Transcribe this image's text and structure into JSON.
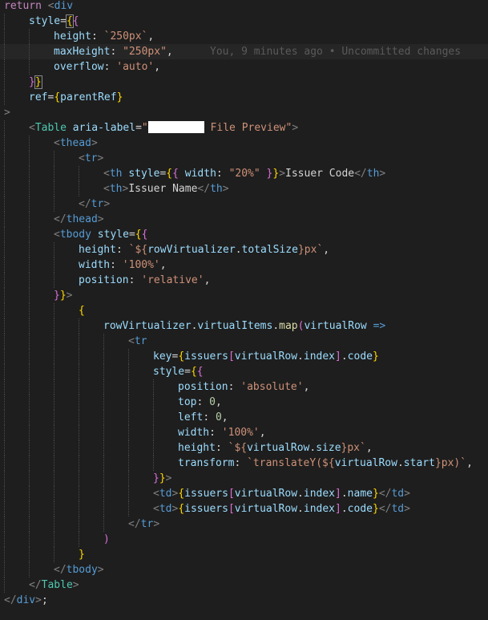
{
  "editor": {
    "blame": "You, 9 minutes ago • Uncommitted changes",
    "lines": [
      {
        "i": 0,
        "t": [
          [
            "kw",
            "return"
          ],
          [
            "txt",
            " "
          ],
          [
            "punc",
            "<"
          ],
          [
            "tag",
            "div"
          ]
        ]
      },
      {
        "i": 1,
        "t": [
          [
            "attr",
            "style"
          ],
          [
            "txt",
            "="
          ],
          [
            "br1",
            "{"
          ],
          [
            "br2",
            "{"
          ]
        ]
      },
      {
        "i": 2,
        "t": [
          [
            "attr",
            "height"
          ],
          [
            "txt",
            ": "
          ],
          [
            "str",
            "`250px`"
          ],
          [
            "txt",
            ","
          ]
        ]
      },
      {
        "i": 2,
        "t": [
          [
            "attr",
            "maxHeight"
          ],
          [
            "txt",
            ": "
          ],
          [
            "str",
            "\"250px\""
          ],
          [
            "txt",
            ","
          ]
        ],
        "blame": true,
        "current": true
      },
      {
        "i": 2,
        "t": [
          [
            "attr",
            "overflow"
          ],
          [
            "txt",
            ": "
          ],
          [
            "str",
            "'auto'"
          ],
          [
            "txt",
            ","
          ]
        ]
      },
      {
        "i": 1,
        "t": [
          [
            "br2",
            "}"
          ],
          [
            "br1",
            "}"
          ]
        ]
      },
      {
        "i": 1,
        "t": [
          [
            "attr",
            "ref"
          ],
          [
            "txt",
            "="
          ],
          [
            "br1",
            "{"
          ],
          [
            "attr",
            "parentRef"
          ],
          [
            "br1",
            "}"
          ]
        ]
      },
      {
        "i": 0,
        "t": [
          [
            "punc",
            ">"
          ]
        ]
      },
      {
        "i": 1,
        "t": [
          [
            "punc",
            "<"
          ],
          [
            "comp",
            "Table"
          ],
          [
            "txt",
            " "
          ],
          [
            "attr",
            "aria-label"
          ],
          [
            "txt",
            "="
          ],
          [
            "str",
            "\""
          ],
          [
            "redact",
            ""
          ],
          [
            "str",
            " File Preview\""
          ],
          [
            "punc",
            ">"
          ]
        ]
      },
      {
        "i": 2,
        "t": [
          [
            "punc",
            "<"
          ],
          [
            "tag",
            "thead"
          ],
          [
            "punc",
            ">"
          ]
        ]
      },
      {
        "i": 3,
        "t": [
          [
            "punc",
            "<"
          ],
          [
            "tag",
            "tr"
          ],
          [
            "punc",
            ">"
          ]
        ]
      },
      {
        "i": 4,
        "t": [
          [
            "punc",
            "<"
          ],
          [
            "tag",
            "th"
          ],
          [
            "txt",
            " "
          ],
          [
            "attr",
            "style"
          ],
          [
            "txt",
            "="
          ],
          [
            "br1",
            "{"
          ],
          [
            "br2",
            "{"
          ],
          [
            "txt",
            " "
          ],
          [
            "attr",
            "width"
          ],
          [
            "txt",
            ": "
          ],
          [
            "str",
            "\"20%\""
          ],
          [
            "txt",
            " "
          ],
          [
            "br2",
            "}"
          ],
          [
            "br1",
            "}"
          ],
          [
            "punc",
            ">"
          ],
          [
            "txt",
            "Issuer Code"
          ],
          [
            "punc",
            "</"
          ],
          [
            "tag",
            "th"
          ],
          [
            "punc",
            ">"
          ]
        ]
      },
      {
        "i": 4,
        "t": [
          [
            "punc",
            "<"
          ],
          [
            "tag",
            "th"
          ],
          [
            "punc",
            ">"
          ],
          [
            "txt",
            "Issuer Name"
          ],
          [
            "punc",
            "</"
          ],
          [
            "tag",
            "th"
          ],
          [
            "punc",
            ">"
          ]
        ]
      },
      {
        "i": 3,
        "t": [
          [
            "punc",
            "</"
          ],
          [
            "tag",
            "tr"
          ],
          [
            "punc",
            ">"
          ]
        ]
      },
      {
        "i": 2,
        "t": [
          [
            "punc",
            "</"
          ],
          [
            "tag",
            "thead"
          ],
          [
            "punc",
            ">"
          ]
        ]
      },
      {
        "i": 2,
        "t": [
          [
            "punc",
            "<"
          ],
          [
            "tag",
            "tbody"
          ],
          [
            "txt",
            " "
          ],
          [
            "attr",
            "style"
          ],
          [
            "txt",
            "="
          ],
          [
            "br1",
            "{"
          ],
          [
            "br2",
            "{"
          ]
        ]
      },
      {
        "i": 3,
        "t": [
          [
            "attr",
            "height"
          ],
          [
            "txt",
            ": "
          ],
          [
            "str",
            "`${"
          ],
          [
            "attr",
            "rowVirtualizer"
          ],
          [
            "txt",
            "."
          ],
          [
            "attr",
            "totalSize"
          ],
          [
            "str",
            "}px`"
          ],
          [
            "txt",
            ","
          ]
        ]
      },
      {
        "i": 3,
        "t": [
          [
            "attr",
            "width"
          ],
          [
            "txt",
            ": "
          ],
          [
            "str",
            "'100%'"
          ],
          [
            "txt",
            ","
          ]
        ]
      },
      {
        "i": 3,
        "t": [
          [
            "attr",
            "position"
          ],
          [
            "txt",
            ": "
          ],
          [
            "str",
            "'relative'"
          ],
          [
            "txt",
            ","
          ]
        ]
      },
      {
        "i": 2,
        "t": [
          [
            "br2",
            "}"
          ],
          [
            "br1",
            "}"
          ],
          [
            "punc",
            ">"
          ]
        ]
      },
      {
        "i": 3,
        "t": [
          [
            "br1",
            "{"
          ]
        ]
      },
      {
        "i": 4,
        "t": [
          [
            "attr",
            "rowVirtualizer"
          ],
          [
            "txt",
            "."
          ],
          [
            "attr",
            "virtualItems"
          ],
          [
            "txt",
            "."
          ],
          [
            "fn",
            "map"
          ],
          [
            "br2",
            "("
          ],
          [
            "attr",
            "virtualRow"
          ],
          [
            "txt",
            " "
          ],
          [
            "tag",
            "=>"
          ]
        ]
      },
      {
        "i": 5,
        "t": [
          [
            "punc",
            "<"
          ],
          [
            "tag",
            "tr"
          ]
        ]
      },
      {
        "i": 6,
        "t": [
          [
            "attr",
            "key"
          ],
          [
            "txt",
            "="
          ],
          [
            "br1",
            "{"
          ],
          [
            "attr",
            "issuers"
          ],
          [
            "br2",
            "["
          ],
          [
            "attr",
            "virtualRow"
          ],
          [
            "txt",
            "."
          ],
          [
            "attr",
            "index"
          ],
          [
            "br2",
            "]"
          ],
          [
            "txt",
            "."
          ],
          [
            "attr",
            "code"
          ],
          [
            "br1",
            "}"
          ]
        ]
      },
      {
        "i": 6,
        "t": [
          [
            "attr",
            "style"
          ],
          [
            "txt",
            "="
          ],
          [
            "br1",
            "{"
          ],
          [
            "br2",
            "{"
          ]
        ]
      },
      {
        "i": 7,
        "t": [
          [
            "attr",
            "position"
          ],
          [
            "txt",
            ": "
          ],
          [
            "str",
            "'absolute'"
          ],
          [
            "txt",
            ","
          ]
        ]
      },
      {
        "i": 7,
        "t": [
          [
            "attr",
            "top"
          ],
          [
            "txt",
            ": "
          ],
          [
            "num",
            "0"
          ],
          [
            "txt",
            ","
          ]
        ]
      },
      {
        "i": 7,
        "t": [
          [
            "attr",
            "left"
          ],
          [
            "txt",
            ": "
          ],
          [
            "num",
            "0"
          ],
          [
            "txt",
            ","
          ]
        ]
      },
      {
        "i": 7,
        "t": [
          [
            "attr",
            "width"
          ],
          [
            "txt",
            ": "
          ],
          [
            "str",
            "'100%'"
          ],
          [
            "txt",
            ","
          ]
        ]
      },
      {
        "i": 7,
        "t": [
          [
            "attr",
            "height"
          ],
          [
            "txt",
            ": "
          ],
          [
            "str",
            "`${"
          ],
          [
            "attr",
            "virtualRow"
          ],
          [
            "txt",
            "."
          ],
          [
            "attr",
            "size"
          ],
          [
            "str",
            "}px`"
          ],
          [
            "txt",
            ","
          ]
        ]
      },
      {
        "i": 7,
        "t": [
          [
            "attr",
            "transform"
          ],
          [
            "txt",
            ": "
          ],
          [
            "str",
            "`translateY("
          ],
          [
            "str",
            "${"
          ],
          [
            "attr",
            "virtualRow"
          ],
          [
            "txt",
            "."
          ],
          [
            "attr",
            "start"
          ],
          [
            "str",
            "}px)`"
          ],
          [
            "txt",
            ","
          ]
        ]
      },
      {
        "i": 6,
        "t": [
          [
            "br2",
            "}"
          ],
          [
            "br1",
            "}"
          ],
          [
            "punc",
            ">"
          ]
        ]
      },
      {
        "i": 6,
        "t": [
          [
            "punc",
            "<"
          ],
          [
            "tag",
            "td"
          ],
          [
            "punc",
            ">"
          ],
          [
            "br1",
            "{"
          ],
          [
            "attr",
            "issuers"
          ],
          [
            "br2",
            "["
          ],
          [
            "attr",
            "virtualRow"
          ],
          [
            "txt",
            "."
          ],
          [
            "attr",
            "index"
          ],
          [
            "br2",
            "]"
          ],
          [
            "txt",
            "."
          ],
          [
            "attr",
            "name"
          ],
          [
            "br1",
            "}"
          ],
          [
            "punc",
            "</"
          ],
          [
            "tag",
            "td"
          ],
          [
            "punc",
            ">"
          ]
        ]
      },
      {
        "i": 6,
        "t": [
          [
            "punc",
            "<"
          ],
          [
            "tag",
            "td"
          ],
          [
            "punc",
            ">"
          ],
          [
            "br1",
            "{"
          ],
          [
            "attr",
            "issuers"
          ],
          [
            "br2",
            "["
          ],
          [
            "attr",
            "virtualRow"
          ],
          [
            "txt",
            "."
          ],
          [
            "attr",
            "index"
          ],
          [
            "br2",
            "]"
          ],
          [
            "txt",
            "."
          ],
          [
            "attr",
            "code"
          ],
          [
            "br1",
            "}"
          ],
          [
            "punc",
            "</"
          ],
          [
            "tag",
            "td"
          ],
          [
            "punc",
            ">"
          ]
        ]
      },
      {
        "i": 5,
        "t": [
          [
            "punc",
            "</"
          ],
          [
            "tag",
            "tr"
          ],
          [
            "punc",
            ">"
          ]
        ]
      },
      {
        "i": 4,
        "t": [
          [
            "br2",
            ")"
          ]
        ]
      },
      {
        "i": 3,
        "t": [
          [
            "br1",
            "}"
          ]
        ]
      },
      {
        "i": 2,
        "t": [
          [
            "punc",
            "</"
          ],
          [
            "tag",
            "tbody"
          ],
          [
            "punc",
            ">"
          ]
        ]
      },
      {
        "i": 1,
        "t": [
          [
            "punc",
            "</"
          ],
          [
            "comp",
            "Table"
          ],
          [
            "punc",
            ">"
          ]
        ]
      },
      {
        "i": 0,
        "t": [
          [
            "punc",
            "</"
          ],
          [
            "tag",
            "div"
          ],
          [
            "punc",
            ">"
          ],
          [
            "txt",
            ";"
          ]
        ]
      }
    ]
  }
}
